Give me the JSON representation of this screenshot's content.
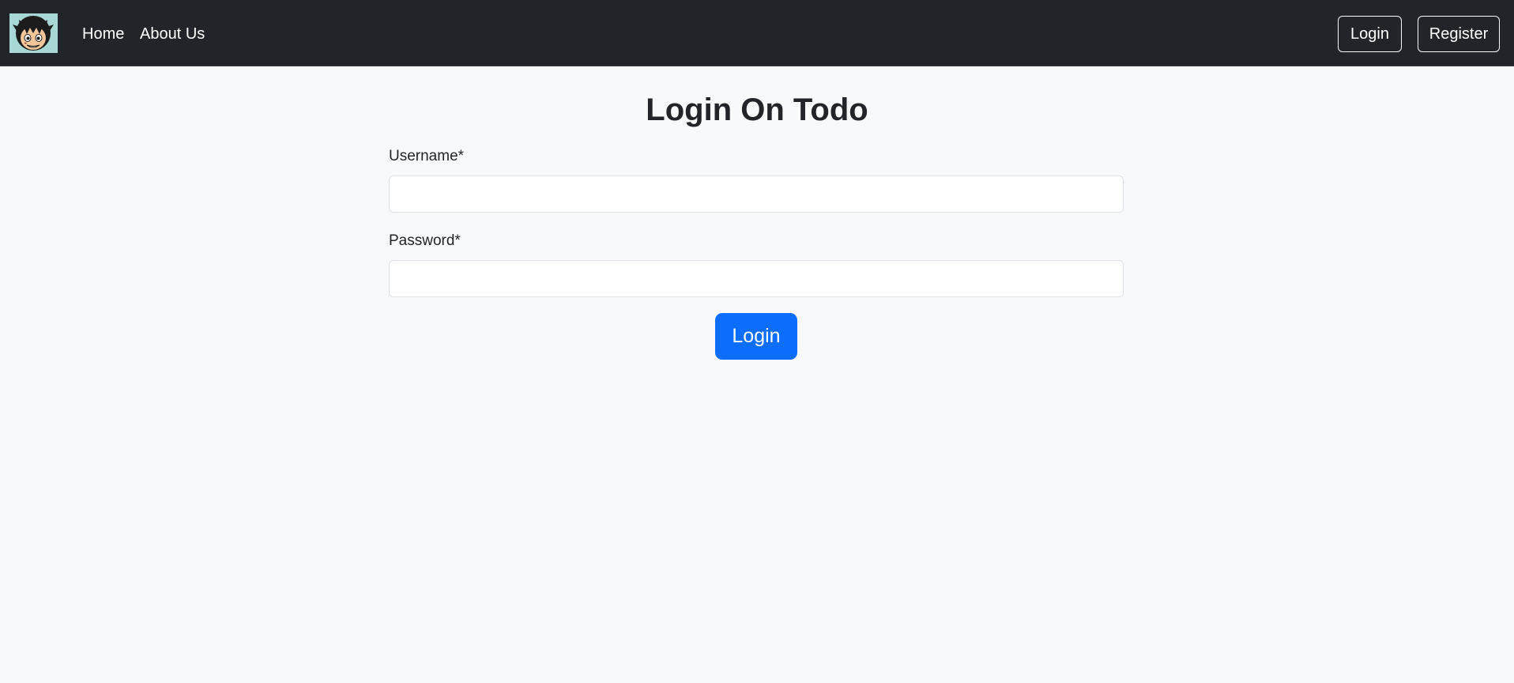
{
  "navbar": {
    "brand_icon": "straw-hat-avatar-icon",
    "links": [
      "Home",
      "About Us"
    ],
    "login_label": "Login",
    "register_label": "Register"
  },
  "main": {
    "title": "Login On Todo",
    "username_label": "Username*",
    "username_value": "",
    "password_label": "Password*",
    "password_value": "",
    "submit_label": "Login"
  },
  "colors": {
    "navbar_bg": "#212529",
    "page_bg": "#f8f9fa",
    "primary": "#0d6efd",
    "brand_bg": "#a8d8d6"
  }
}
